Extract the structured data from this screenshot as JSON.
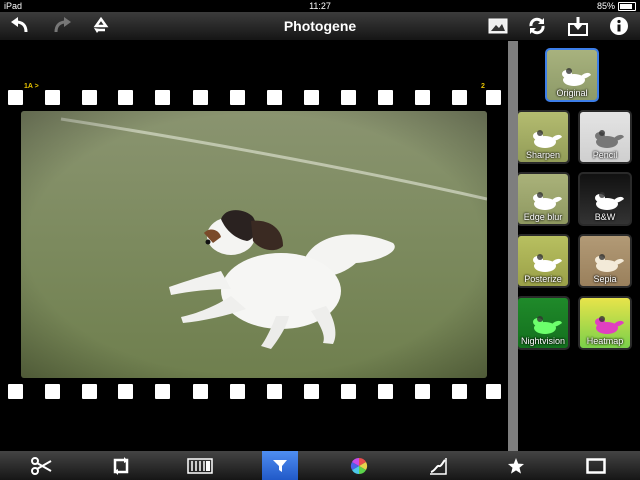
{
  "status": {
    "carrier": "iPad",
    "time": "11:27",
    "battery": "85%",
    "battery_level": 0.85
  },
  "app": {
    "title": "Photogene"
  },
  "toolbar_top": {
    "left": [
      {
        "icon": "undo-icon"
      },
      {
        "icon": "redo-icon"
      },
      {
        "icon": "recycle-icon"
      }
    ],
    "right": [
      {
        "icon": "image-icon"
      },
      {
        "icon": "refresh-icon"
      },
      {
        "icon": "save-icon"
      },
      {
        "icon": "info-icon"
      }
    ]
  },
  "film": {
    "frame_label": "1A",
    "arrow": ">",
    "frame_number": "2"
  },
  "filters": [
    {
      "label": "Original",
      "selected": true
    },
    {
      "label": "Sharpen"
    },
    {
      "label": "Pencil"
    },
    {
      "label": "Edge blur"
    },
    {
      "label": "B&W"
    },
    {
      "label": "Posterize"
    },
    {
      "label": "Sepia"
    },
    {
      "label": "Nightvision"
    },
    {
      "label": "Heatmap"
    }
  ],
  "bottom_tools": [
    {
      "icon": "scissors-icon"
    },
    {
      "icon": "rotate-icon"
    },
    {
      "icon": "adjust-levels-icon"
    },
    {
      "icon": "filter-icon",
      "active": true
    },
    {
      "icon": "color-wheel-icon"
    },
    {
      "icon": "curves-icon"
    },
    {
      "icon": "star-icon"
    },
    {
      "icon": "frame-icon"
    }
  ]
}
